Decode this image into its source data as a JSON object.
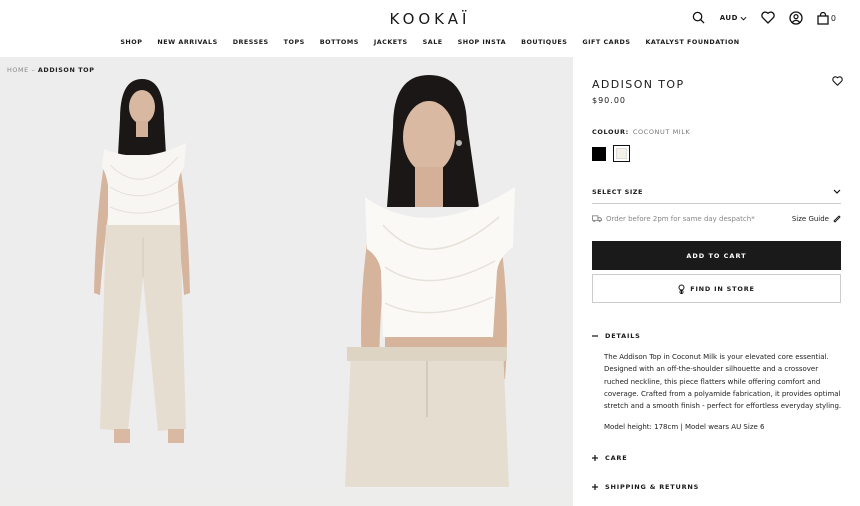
{
  "header": {
    "logo": "KOOKAÏ",
    "currency": "AUD",
    "cart_count": "0"
  },
  "nav": {
    "items": [
      "SHOP",
      "NEW ARRIVALS",
      "DRESSES",
      "TOPS",
      "BOTTOMS",
      "JACKETS",
      "SALE",
      "SHOP INSTA",
      "BOUTIQUES",
      "GIFT CARDS",
      "KATALYST FOUNDATION"
    ]
  },
  "breadcrumb": {
    "home": "HOME",
    "separator": "–",
    "current": "ADDISON TOP"
  },
  "product": {
    "title": "ADDISON TOP",
    "price": "$90.00",
    "colour_label": "COLOUR:",
    "colour_value": "COCONUT MILK",
    "swatches": [
      {
        "name": "Black",
        "color": "#000000"
      },
      {
        "name": "Coconut Milk",
        "color": "#f5f1e6",
        "selected": true
      }
    ],
    "select_size": "SELECT SIZE",
    "despatch": "Order before 2pm for same day despatch*",
    "size_guide": "Size Guide",
    "add_to_cart": "ADD TO CART",
    "find_in_store": "FIND IN STORE"
  },
  "details": {
    "title": "DETAILS",
    "description": "The Addison Top in Coconut Milk is your elevated core essential. Designed with an off-the-shoulder silhouette and a crossover ruched neckline, this piece flatters while offering comfort and coverage. Crafted from a polyamide fabrication, it provides optimal stretch and a smooth finish - perfect for effortless everyday styling.",
    "model": "Model height: 178cm | Model wears AU Size 6"
  },
  "care": {
    "title": "CARE"
  },
  "shipping": {
    "title": "SHIPPING & RETURNS"
  }
}
